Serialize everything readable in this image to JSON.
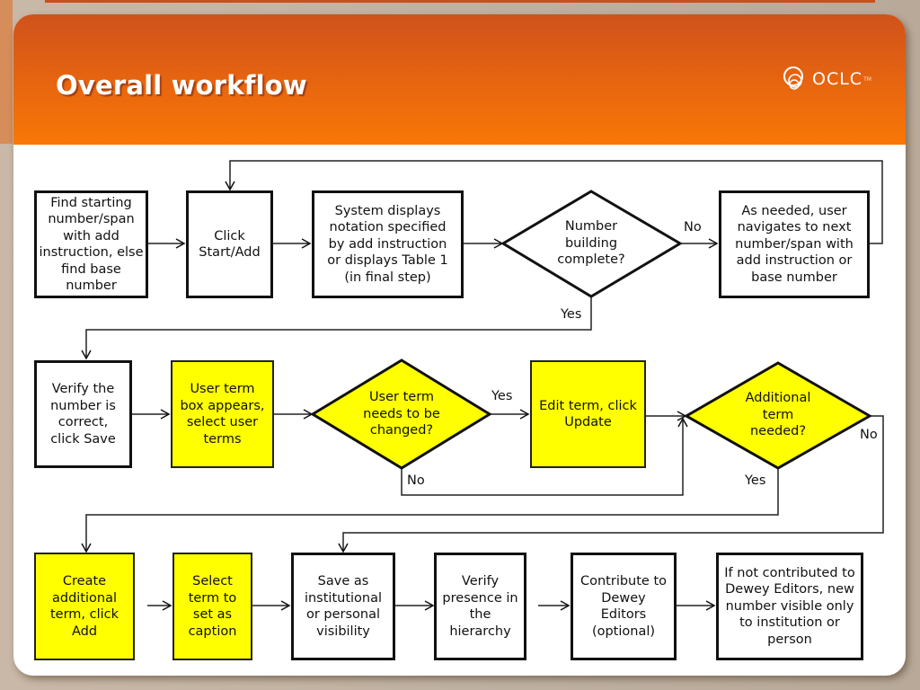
{
  "slide": {
    "title": "Overall workflow",
    "logo": {
      "icon": "oclc-logo-icon",
      "text": "OCLC",
      "tm": "TM"
    }
  },
  "colors": {
    "header_top": "#cf521c",
    "header_bottom": "#f97806",
    "highlight_yellow": "#ffff00",
    "line": "#111111"
  },
  "nodes": {
    "find_start": "Find starting number/span with add instruction, else find base number",
    "click_start": "Click Start/Add",
    "system_displays": "System displays notation specified by add instruction or displays Table 1 (in final step)",
    "number_complete": "Number building complete?",
    "navigate_next": "As needed, user navigates to next number/span with add instruction or base number",
    "verify_number": "Verify the number is correct, click Save",
    "user_term_box": "User term box appears, select user terms",
    "term_change": "User term needs to be changed?",
    "edit_term": "Edit term, click Update",
    "additional_term": "Additional term needed?",
    "create_term": "Create additional term, click Add",
    "select_caption": "Select term to set as caption",
    "save_visibility": "Save as institutional or personal visibility",
    "verify_presence": "Verify presence in the hierarchy",
    "contribute": "Contribute to Dewey Editors (optional)",
    "not_contributed": "If not contributed to Dewey Editors, new number visible only to institution or person"
  },
  "labels": {
    "complete_no": "No",
    "complete_yes": "Yes",
    "change_yes": "Yes",
    "change_no": "No",
    "additional_yes": "Yes",
    "additional_no": "No"
  }
}
